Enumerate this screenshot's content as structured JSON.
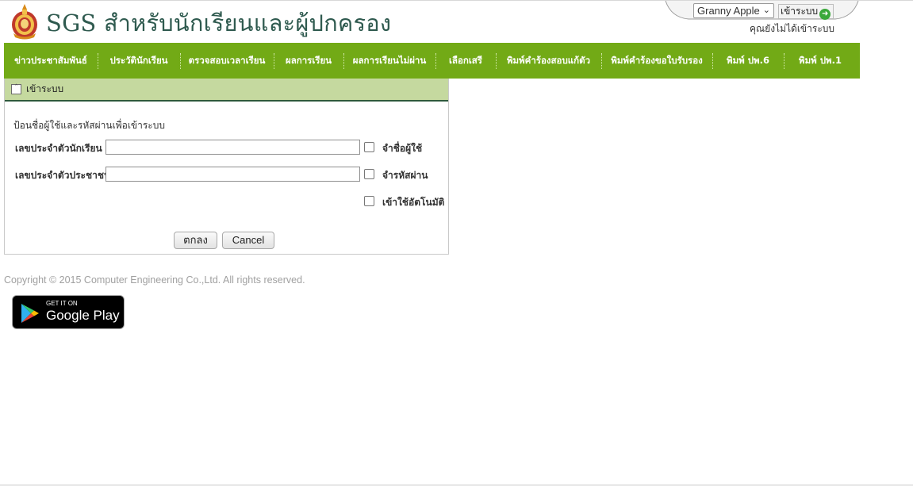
{
  "header": {
    "title": "SGS สำหรับนักเรียนและผู้ปกครอง",
    "user_select_value": "Granny Apple",
    "login_label": "เข้าระบบ",
    "login_status": "คุณยังไม่ได้เข้าระบบ"
  },
  "nav": {
    "items": [
      {
        "label": "ข่าวประชาสัมพันธ์"
      },
      {
        "label": "ประวัตินักเรียน"
      },
      {
        "label": "ตรวจสอบเวลาเรียน"
      },
      {
        "label": "ผลการเรียน"
      },
      {
        "label": "ผลการเรียนไม่ผ่าน"
      },
      {
        "label": "เลือกเสรี"
      },
      {
        "label": "พิมพ์คำร้องสอบแก้ตัว"
      },
      {
        "label": "พิมพ์คำร้องขอใบรับรอง"
      },
      {
        "label": "พิมพ์ ปพ.6"
      },
      {
        "label": "พิมพ์ ปพ.1"
      }
    ]
  },
  "login_panel": {
    "title": "เข้าระบบ",
    "instruction": "ป้อนชื่อผู้ใช้และรหัสผ่านเพื่อเข้าระบบ",
    "student_id_label": "เลขประจำตัวนักเรียน",
    "citizen_id_label": "เลขประจำตัวประชาชน",
    "remember_user_label": "จำชื่อผู้ใช้",
    "remember_password_label": "จำรหัสผ่าน",
    "auto_login_label": "เข้าใช้อัตโนมัติ",
    "ok_label": "ตกลง",
    "cancel_label": "Cancel"
  },
  "footer": {
    "copyright": "Copyright © 2015 Computer Engineering Co.,Ltd. All rights reserved.",
    "gplay_small": "GET IT ON",
    "gplay_big": "Google Play"
  },
  "colors": {
    "nav_green": "#72aa16",
    "panel_header": "#c5d99f",
    "title_color": "#2f5a4f"
  },
  "icons": [
    "school-crest-icon",
    "chevron-down-icon",
    "go-arrow-icon",
    "collapse-up-icon",
    "google-play-icon"
  ]
}
